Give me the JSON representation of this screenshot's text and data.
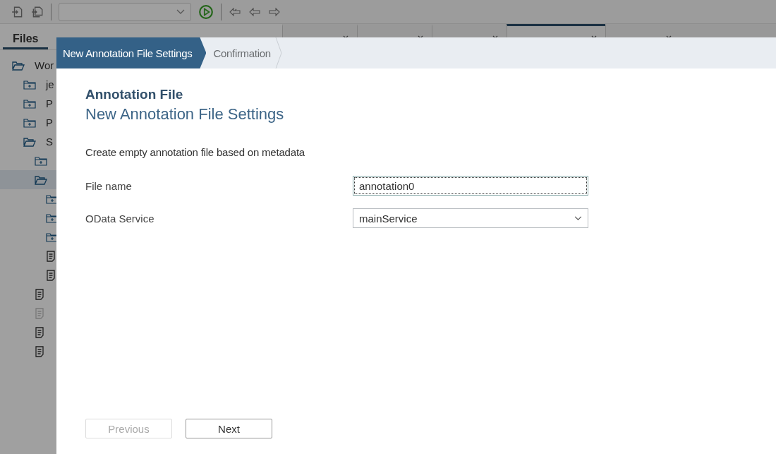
{
  "panel_tabs": [
    {
      "label": "Files",
      "selected": true
    }
  ],
  "editor_tabs": [
    {
      "selected": false
    },
    {
      "selected": false
    },
    {
      "selected": false
    },
    {
      "selected": true
    },
    {
      "selected": false
    }
  ],
  "tree": [
    {
      "label": "Wor",
      "kind": "folder",
      "expanded": true,
      "children": [
        {
          "label": "je",
          "kind": "folder",
          "expanded": false
        },
        {
          "label": "P",
          "kind": "folder",
          "expanded": false
        },
        {
          "label": "P",
          "kind": "folder",
          "expanded": false
        },
        {
          "label": "S",
          "kind": "folder",
          "expanded": true,
          "children": [
            {
              "kind": "folder",
              "expanded": false
            },
            {
              "kind": "folder",
              "expanded": true,
              "selected": true,
              "children": [
                {
                  "kind": "folder",
                  "expanded": false
                },
                {
                  "kind": "folder",
                  "expanded": false
                },
                {
                  "kind": "folder",
                  "expanded": false
                },
                {
                  "kind": "file",
                  "disabled": false
                },
                {
                  "kind": "file",
                  "disabled": false
                }
              ]
            },
            {
              "kind": "file",
              "disabled": false
            },
            {
              "kind": "file",
              "disabled": true
            },
            {
              "kind": "file",
              "disabled": false
            },
            {
              "kind": "file",
              "disabled": false
            }
          ]
        }
      ]
    }
  ],
  "wizard": {
    "steps": [
      {
        "label": "New Annotation File Settings",
        "selected": true
      },
      {
        "label": "Confirmation",
        "selected": false
      }
    ],
    "heading": "Annotation File",
    "title": "New Annotation File Settings",
    "description": "Create empty annotation file based on metadata",
    "fields": [
      {
        "label": "File name",
        "kind": "text",
        "value": "annotation0",
        "focused": true
      },
      {
        "label": "OData Service",
        "kind": "select",
        "value": "mainService",
        "focused": false
      }
    ],
    "buttons": [
      {
        "label": "Previous",
        "disabled": true
      },
      {
        "label": "Next",
        "disabled": false
      }
    ]
  }
}
